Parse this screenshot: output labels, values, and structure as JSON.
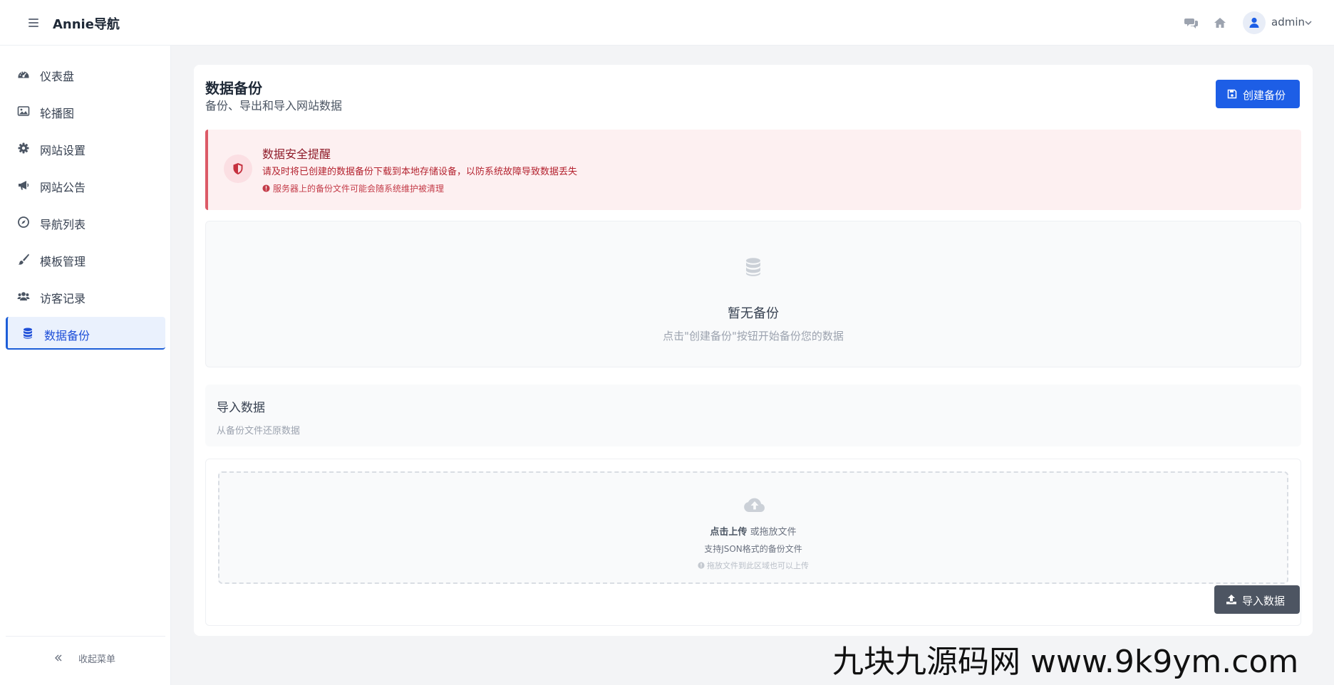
{
  "header": {
    "brand": "Annie导航",
    "user_name": "admin"
  },
  "sidebar": {
    "items": [
      {
        "label": "仪表盘",
        "icon": "dashboard-icon"
      },
      {
        "label": "轮播图",
        "icon": "image-icon"
      },
      {
        "label": "网站设置",
        "icon": "gear-icon"
      },
      {
        "label": "网站公告",
        "icon": "megaphone-icon"
      },
      {
        "label": "导航列表",
        "icon": "compass-icon"
      },
      {
        "label": "模板管理",
        "icon": "brush-icon"
      },
      {
        "label": "访客记录",
        "icon": "users-icon"
      },
      {
        "label": "数据备份",
        "icon": "database-icon",
        "active": true
      }
    ],
    "collapse_label": "收起菜单"
  },
  "page": {
    "title": "数据备份",
    "subtitle": "备份、导出和导入网站数据",
    "create_button": "创建备份"
  },
  "alert": {
    "title": "数据安全提醒",
    "text": "请及时将已创建的数据备份下载到本地存储设备，以防系统故障导致数据丢失",
    "note": "服务器上的备份文件可能会随系统维护被清理"
  },
  "empty": {
    "title": "暂无备份",
    "desc": "点击\"创建备份\"按钮开始备份您的数据"
  },
  "import": {
    "title": "导入数据",
    "subtitle": "从备份文件还原数据",
    "upload_strong": "点击上传",
    "upload_rest": " 或拖放文件",
    "format_hint": "支持JSON格式的备份文件",
    "drag_hint": "拖放文件到此区域也可以上传",
    "button": "导入数据"
  },
  "watermark": "九块九源码网 www.9k9ym.com",
  "colors": {
    "primary": "#1d5ee6",
    "alert_border": "#dc5a67",
    "alert_bg": "#fdf0f1",
    "import_button": "#4d5562"
  }
}
